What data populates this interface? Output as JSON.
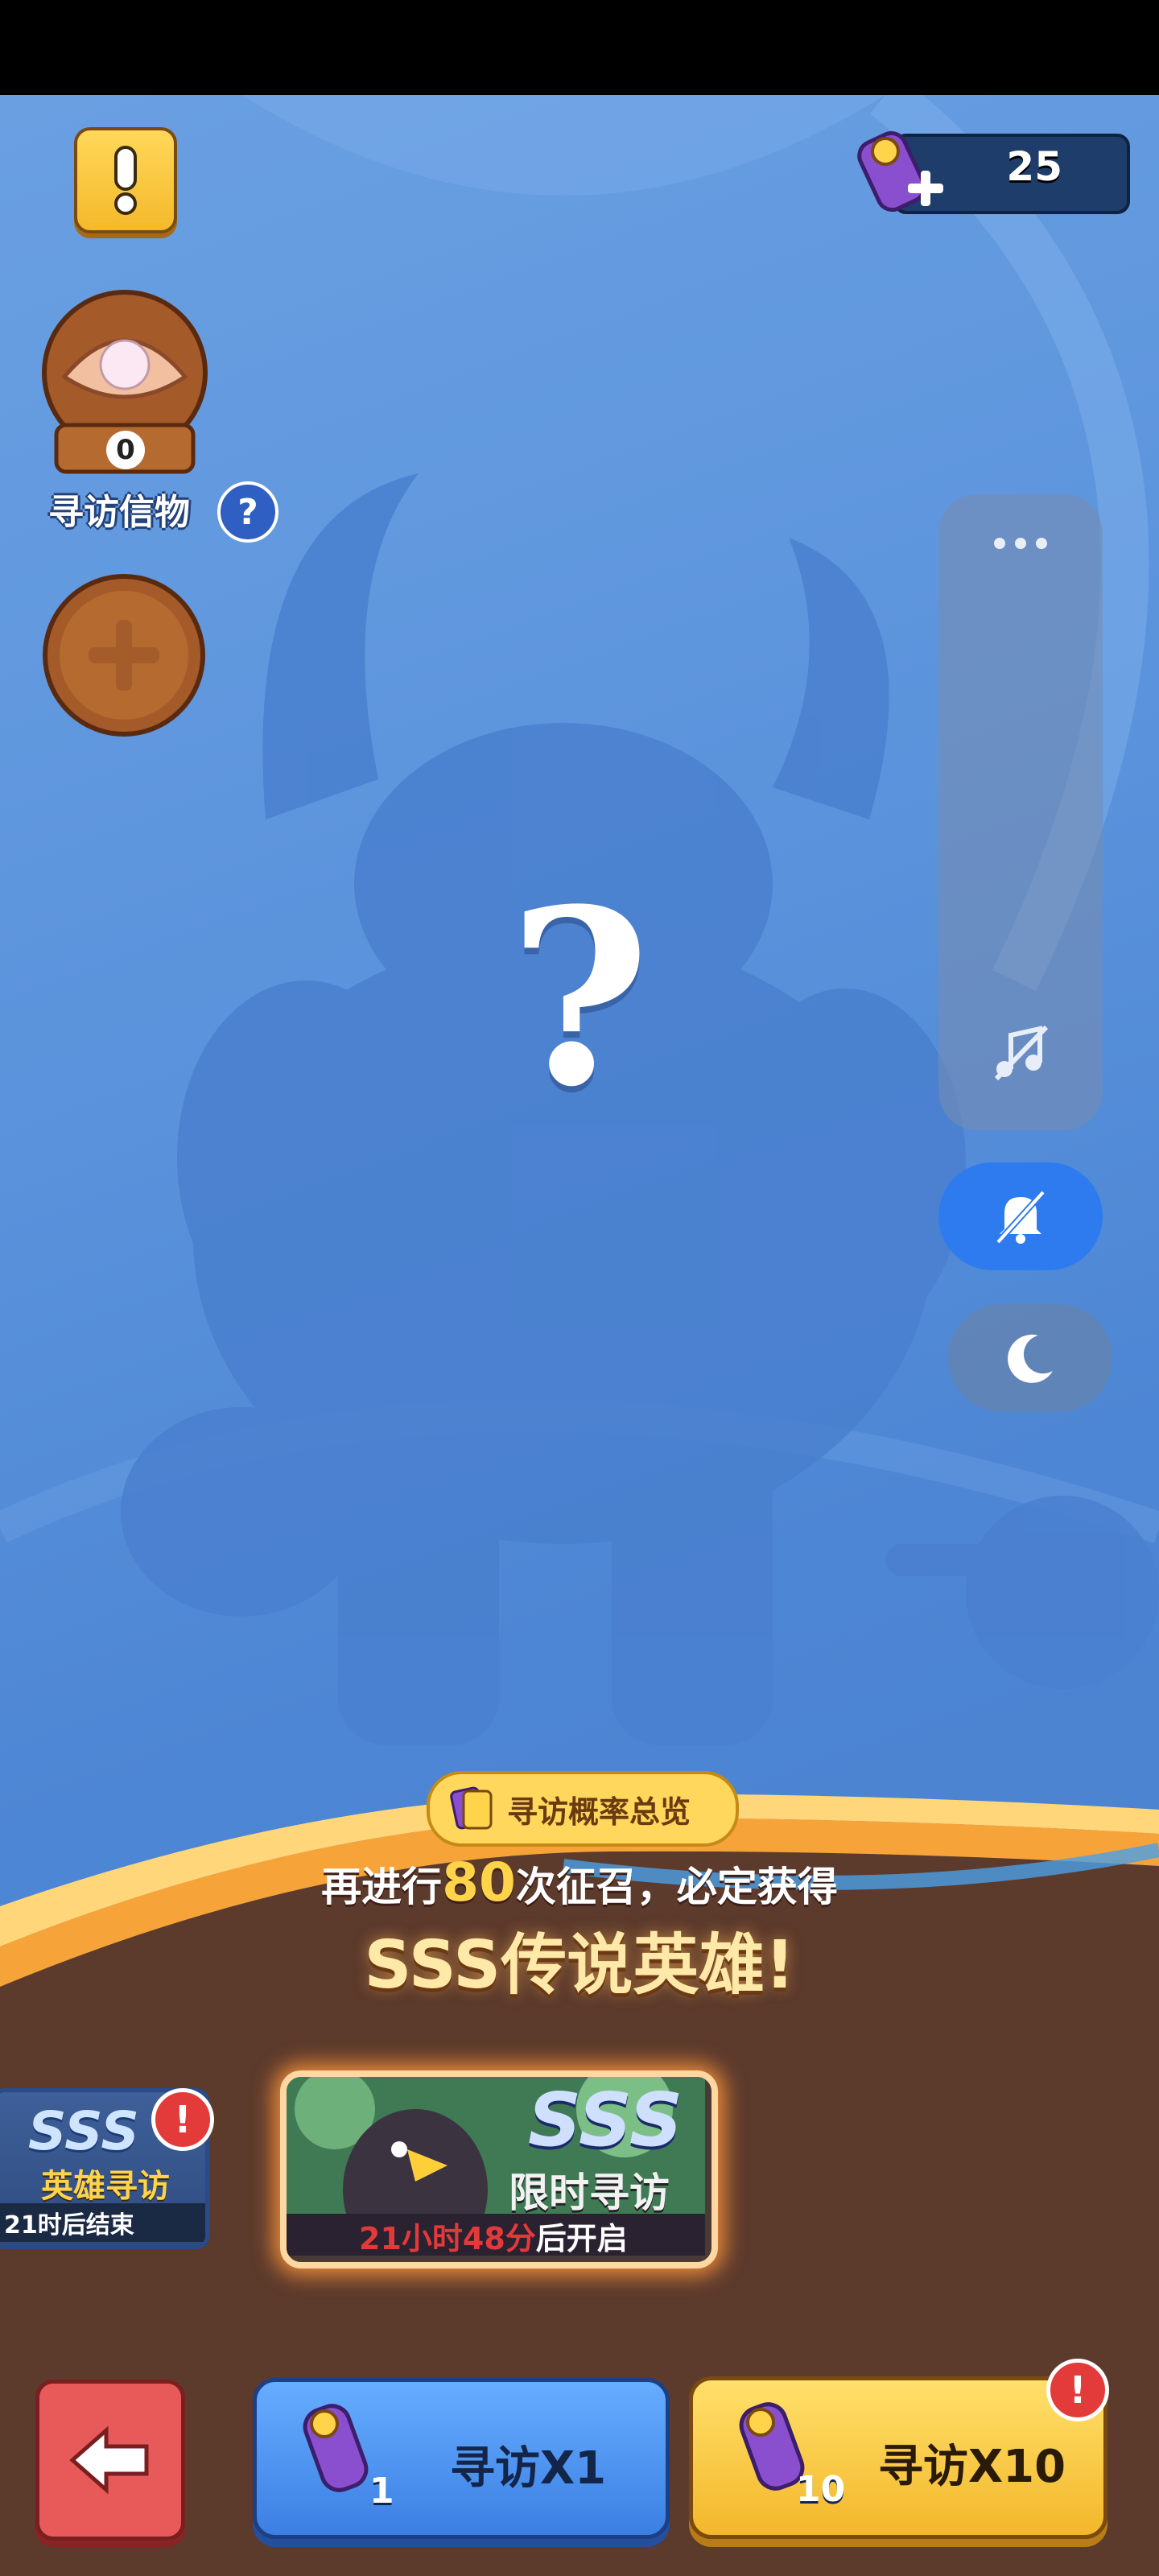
{
  "currency": {
    "value": "25"
  },
  "pearl": {
    "count": "0"
  },
  "xunfang_label": "寻访信物",
  "help_symbol": "?",
  "mystery_symbol": "?",
  "probability_button": {
    "label": "寻访概率总览"
  },
  "summon_info": {
    "prefix": "再进行",
    "count": "80",
    "suffix": "次征召，必定获得",
    "reward": "SSS传说英雄!"
  },
  "banners": {
    "hero": {
      "sss": "SSS",
      "title": "英雄寻访",
      "timer": "21时后结束"
    },
    "limited": {
      "sss": "SSS",
      "title": "限时寻访",
      "timer_red": "21小时48分",
      "timer_suffix": "后开启"
    }
  },
  "buttons": {
    "visit1": {
      "label": "寻访X1",
      "count": "1"
    },
    "visit10": {
      "label": "寻访X10",
      "count": "10"
    }
  },
  "badge_symbol": "!",
  "icons": [
    "alert-icon",
    "scroll-icon",
    "plus-icon",
    "pearl-icon",
    "help-icon",
    "more-icon",
    "music-off-icon",
    "bell-off-icon",
    "moon-icon",
    "card-icon",
    "back-arrow-icon"
  ],
  "colors": {
    "accent_yellow": "#ffd44a",
    "button_blue": "#3c7fe3",
    "button_yellow": "#f3b72b",
    "back_red": "#e85a5a"
  }
}
